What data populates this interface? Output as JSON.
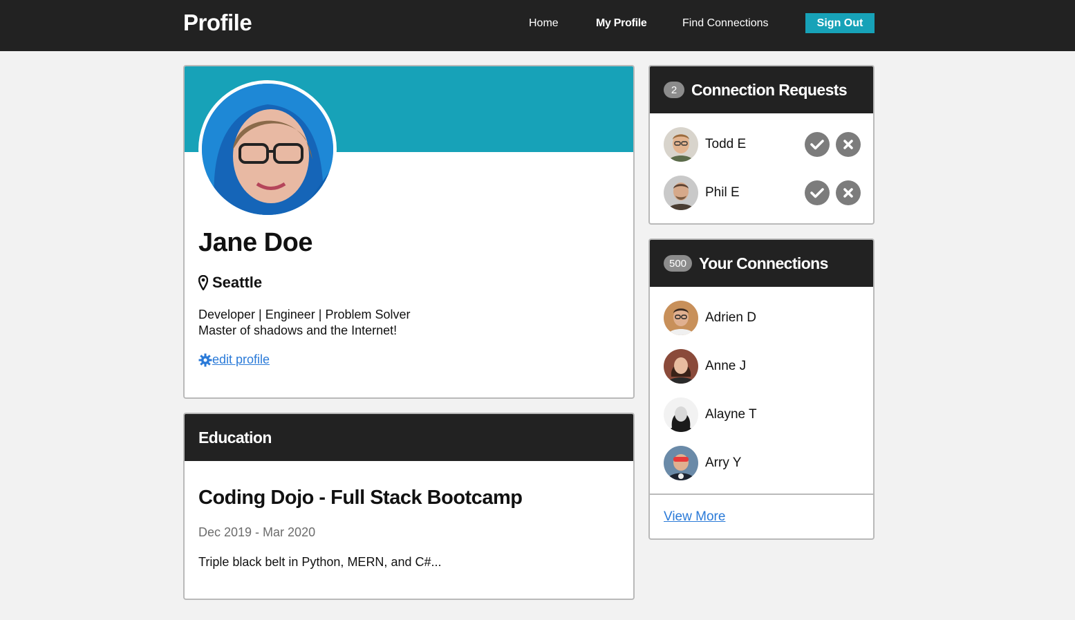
{
  "nav": {
    "brand": "Profile",
    "links": [
      "Home",
      "My Profile",
      "Find Connections"
    ],
    "active": "My Profile",
    "sign_out": "Sign Out"
  },
  "profile": {
    "name": "Jane Doe",
    "location": "Seattle",
    "bio_line1": "Developer | Engineer | Problem Solver",
    "bio_line2": "Master of shadows and the Internet!",
    "edit_label": " edit profile"
  },
  "education": {
    "header": "Education",
    "school": "Coding Dojo - Full Stack Bootcamp",
    "dates": "Dec 2019 - Mar 2020",
    "description": "Triple black belt in Python, MERN, and C#..."
  },
  "requests": {
    "title": "Connection Requests",
    "count": "2",
    "people": [
      {
        "name": "Todd E"
      },
      {
        "name": "Phil E"
      }
    ]
  },
  "connections": {
    "title": "Your Connections",
    "count": "500",
    "people": [
      {
        "name": "Adrien D"
      },
      {
        "name": "Anne J"
      },
      {
        "name": "Alayne T"
      },
      {
        "name": "Arry Y"
      }
    ],
    "view_more": "View More"
  },
  "colors": {
    "accent": "#17a2b8",
    "header_dark": "#222222",
    "link": "#2a7ad8"
  }
}
